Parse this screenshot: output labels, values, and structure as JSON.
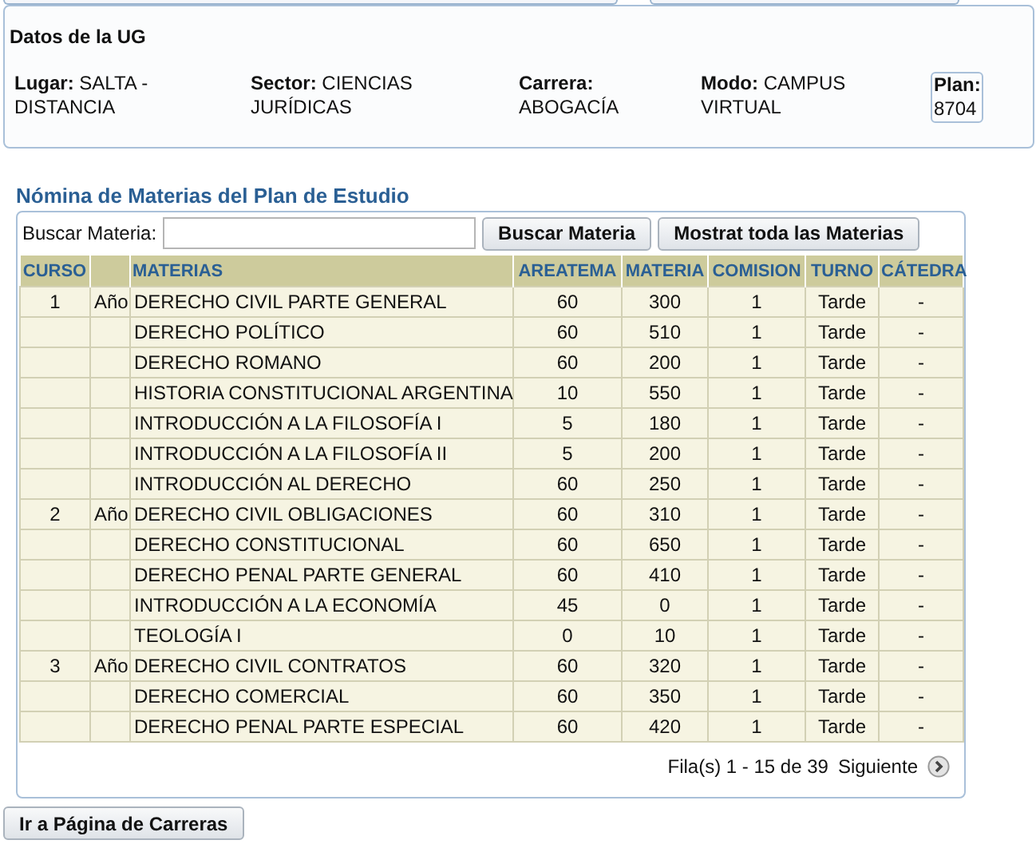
{
  "ug": {
    "title": "Datos de la UG",
    "fields": [
      {
        "label": "Lugar:",
        "value": "SALTA - DISTANCIA"
      },
      {
        "label": "Sector:",
        "value": "CIENCIAS JURÍDICAS"
      },
      {
        "label": "Carrera:",
        "value": "ABOGACÍA"
      },
      {
        "label": "Modo:",
        "value": "CAMPUS VIRTUAL"
      },
      {
        "label": "Plan:",
        "value": "8704",
        "kind": "boxed"
      }
    ]
  },
  "section_title": "Nómina de Materias del Plan de Estudio",
  "search": {
    "label": "Buscar Materia:",
    "buttons": [
      "Buscar Materia",
      "Mostrat toda las Materias"
    ]
  },
  "table": {
    "columns": [
      "CURSO",
      "",
      "MATERIAS",
      "AREATEMA",
      "MATERIA",
      "COMISION",
      "TURNO",
      "CÁTEDRA"
    ],
    "rows": [
      [
        "1",
        "Año",
        "DERECHO CIVIL PARTE GENERAL",
        "60",
        "300",
        "1",
        "Tarde",
        "-"
      ],
      [
        "",
        "",
        "DERECHO POLÍTICO",
        "60",
        "510",
        "1",
        "Tarde",
        "-"
      ],
      [
        "",
        "",
        "DERECHO ROMANO",
        "60",
        "200",
        "1",
        "Tarde",
        "-"
      ],
      [
        "",
        "",
        "HISTORIA CONSTITUCIONAL ARGENTINA",
        "10",
        "550",
        "1",
        "Tarde",
        "-"
      ],
      [
        "",
        "",
        "INTRODUCCIÓN A LA FILOSOFÍA I",
        "5",
        "180",
        "1",
        "Tarde",
        "-"
      ],
      [
        "",
        "",
        "INTRODUCCIÓN A LA FILOSOFÍA II",
        "5",
        "200",
        "1",
        "Tarde",
        "-"
      ],
      [
        "",
        "",
        "INTRODUCCIÓN AL DERECHO",
        "60",
        "250",
        "1",
        "Tarde",
        "-"
      ],
      [
        "2",
        "Año",
        "DERECHO CIVIL OBLIGACIONES",
        "60",
        "310",
        "1",
        "Tarde",
        "-"
      ],
      [
        "",
        "",
        "DERECHO CONSTITUCIONAL",
        "60",
        "650",
        "1",
        "Tarde",
        "-"
      ],
      [
        "",
        "",
        "DERECHO PENAL PARTE GENERAL",
        "60",
        "410",
        "1",
        "Tarde",
        "-"
      ],
      [
        "",
        "",
        "INTRODUCCIÓN A LA ECONOMÍA",
        "45",
        "0",
        "1",
        "Tarde",
        "-"
      ],
      [
        "",
        "",
        "TEOLOGÍA I",
        "0",
        "10",
        "1",
        "Tarde",
        "-"
      ],
      [
        "3",
        "Año",
        "DERECHO CIVIL CONTRATOS",
        "60",
        "320",
        "1",
        "Tarde",
        "-"
      ],
      [
        "",
        "",
        "DERECHO COMERCIAL",
        "60",
        "350",
        "1",
        "Tarde",
        "-"
      ],
      [
        "",
        "",
        "DERECHO PENAL PARTE ESPECIAL",
        "60",
        "420",
        "1",
        "Tarde",
        "-"
      ]
    ]
  },
  "pager": {
    "range": "Fila(s) 1 - 15 de 39",
    "next": "Siguiente"
  },
  "back_button": "Ir a Página de Carreras"
}
